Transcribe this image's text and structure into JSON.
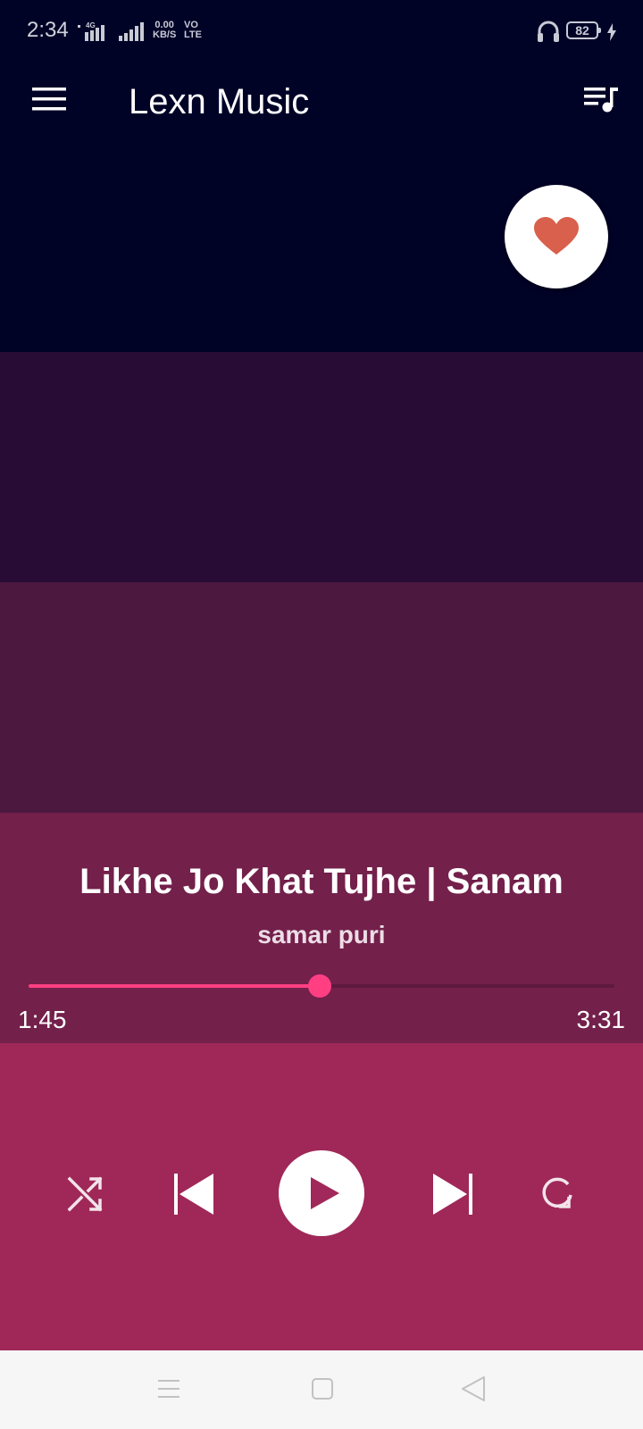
{
  "status_bar": {
    "time": "2:34",
    "network_type": "4G",
    "data_speed_value": "0.00",
    "data_speed_unit": "KB/S",
    "volte_top": "VO",
    "volte_bottom": "LTE",
    "battery_level": "82"
  },
  "app_bar": {
    "title": "Lexn Music",
    "menu_icon": "hamburger-menu-icon",
    "queue_icon": "playlist-music-icon"
  },
  "favorite": {
    "icon": "heart-icon",
    "heart_color": "#d9604c"
  },
  "now_playing": {
    "title": "Likhe Jo Khat Tujhe | Sanam",
    "artist": "samar puri",
    "elapsed": "1:45",
    "total": "3:31",
    "progress_fraction": 0.4976
  },
  "controls": {
    "shuffle_icon": "shuffle-icon",
    "previous_icon": "skip-previous-icon",
    "play_icon": "play-icon",
    "next_icon": "skip-next-icon",
    "repeat_icon": "repeat-icon"
  },
  "colors": {
    "accent": "#ff3f82",
    "bands": [
      "#000226",
      "#290c35",
      "#4c1840",
      "#73204b",
      "#9f2858"
    ]
  }
}
